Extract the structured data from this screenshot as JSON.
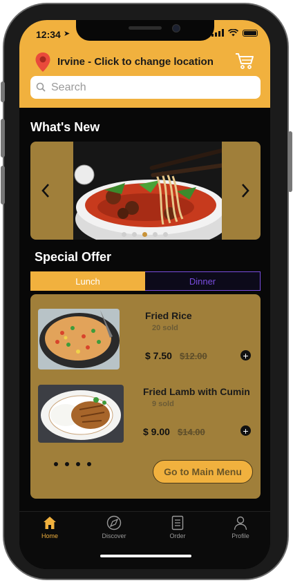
{
  "status": {
    "time": "12:34",
    "arrow": "➤"
  },
  "header": {
    "location": "Irvine - Click to change location",
    "search_placeholder": "Search",
    "cart_icon": "cart-icon"
  },
  "whats_new": {
    "title": "What's New",
    "dot_count": 5,
    "active_dot": 3
  },
  "special_offer": {
    "title": "Special Offer",
    "tabs": [
      {
        "label": "Lunch",
        "active": true
      },
      {
        "label": "Dinner",
        "active": false
      }
    ],
    "items": [
      {
        "name": "Fried Rice",
        "sold": "20 sold",
        "price": "$ 7.50",
        "old_price": "$12.00"
      },
      {
        "name": "Fried Lamb with Cumin",
        "sold": "9 sold",
        "price": "$ 9.00",
        "old_price": "$14.00"
      }
    ],
    "page_dot_count": 4,
    "main_menu_label": "Go to Main Menu"
  },
  "tabbar": [
    {
      "label": "Home",
      "icon": "home-icon",
      "active": true
    },
    {
      "label": "Discover",
      "icon": "compass-icon",
      "active": false
    },
    {
      "label": "Order",
      "icon": "document-icon",
      "active": false
    },
    {
      "label": "Profile",
      "icon": "person-icon",
      "active": false
    }
  ],
  "colors": {
    "accent": "#f1b13e",
    "card": "#a07f3a",
    "background": "#080808",
    "dinner_tab": "#7a4de0"
  }
}
